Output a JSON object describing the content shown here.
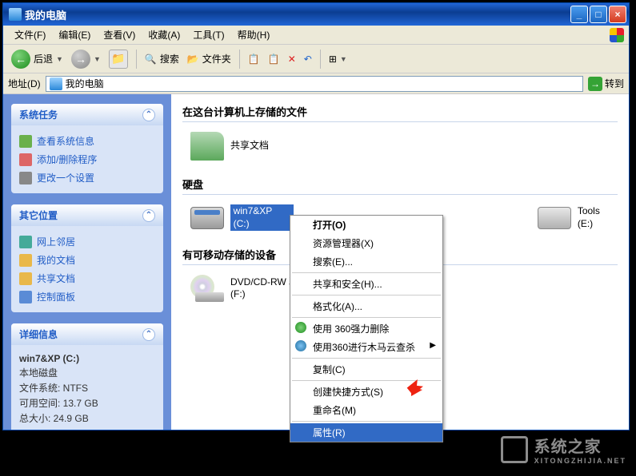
{
  "titlebar": {
    "title": "我的电脑"
  },
  "menubar": {
    "file": "文件(F)",
    "edit": "编辑(E)",
    "view": "查看(V)",
    "fav": "收藏(A)",
    "tools": "工具(T)",
    "help": "帮助(H)"
  },
  "toolbar": {
    "back": "后退",
    "search": "搜索",
    "folders": "文件夹"
  },
  "addrbar": {
    "label": "地址(D)",
    "value": "我的电脑",
    "go": "转到"
  },
  "sidebar": {
    "panel1": {
      "title": "系统任务",
      "items": [
        {
          "label": "查看系统信息",
          "ic": "ic1"
        },
        {
          "label": "添加/删除程序",
          "ic": "ic2"
        },
        {
          "label": "更改一个设置",
          "ic": "ic3"
        }
      ]
    },
    "panel2": {
      "title": "其它位置",
      "items": [
        {
          "label": "网上邻居",
          "ic": "ic4"
        },
        {
          "label": "我的文档",
          "ic": "ic5"
        },
        {
          "label": "共享文档",
          "ic": "ic6"
        },
        {
          "label": "控制面板",
          "ic": "ic7"
        }
      ]
    },
    "panel3": {
      "title": "详细信息",
      "lines": {
        "l1": "win7&XP (C:)",
        "l2": "本地磁盘",
        "l3": "文件系统: NTFS",
        "l4": "可用空间: 13.7 GB",
        "l5": "总大小: 24.9 GB"
      }
    }
  },
  "main": {
    "sec_files": "在这台计算机上存储的文件",
    "shared_docs": "共享文档",
    "sec_hdd": "硬盘",
    "drive_c_label": "win7&XP (C:)",
    "drive_e_label": "Tools (E:)",
    "sec_removable": "有可移动存储的设备",
    "dvd_label_1": "DVD/CD-RW 驱",
    "dvd_label_2": "(F:)"
  },
  "ctx": {
    "open": "打开(O)",
    "explorer": "资源管理器(X)",
    "search": "搜索(E)...",
    "share": "共享和安全(H)...",
    "format": "格式化(A)...",
    "del360": "使用 360强力删除",
    "scan360": "使用360进行木马云查杀",
    "copy": "复制(C)",
    "shortcut": "创建快捷方式(S)",
    "rename": "重命名(M)",
    "props": "属性(R)"
  },
  "watermark": {
    "text": "系统之家",
    "sub": "XITONGZHIJIA.NET"
  }
}
